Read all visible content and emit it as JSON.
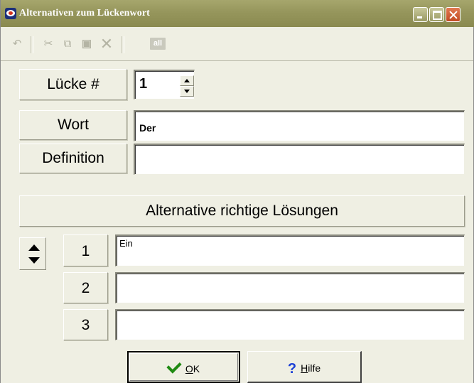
{
  "window": {
    "title": "Alternativen zum Lückenwort"
  },
  "toolbar": {
    "undo_icon": "undo-icon",
    "cut_icon": "scissors-icon",
    "copy_icon": "copy-icon",
    "paste_icon": "paste-icon",
    "delete_icon": "delete-x-icon",
    "all_label": "all"
  },
  "form": {
    "gap_label": "Lücke #",
    "gap_value": "1",
    "word_label": "Wort",
    "word_value": "Der",
    "definition_label": "Definition",
    "definition_value": "",
    "alternatives_heading": "Alternative richtige Lösungen",
    "alternatives": [
      {
        "number": "1",
        "value": "Ein"
      },
      {
        "number": "2",
        "value": ""
      },
      {
        "number": "3",
        "value": ""
      }
    ]
  },
  "buttons": {
    "ok_label": "OK",
    "ok_mnemonic": "O",
    "ok_rest": "K",
    "help_label": "Hilfe",
    "help_mnemonic": "H",
    "help_rest": "ilfe"
  },
  "colors": {
    "titlebar": "#96965c",
    "face": "#efefe3",
    "close_button": "#c24a22",
    "ok_check": "#1f8a12",
    "help_mark": "#1b3fd6"
  }
}
